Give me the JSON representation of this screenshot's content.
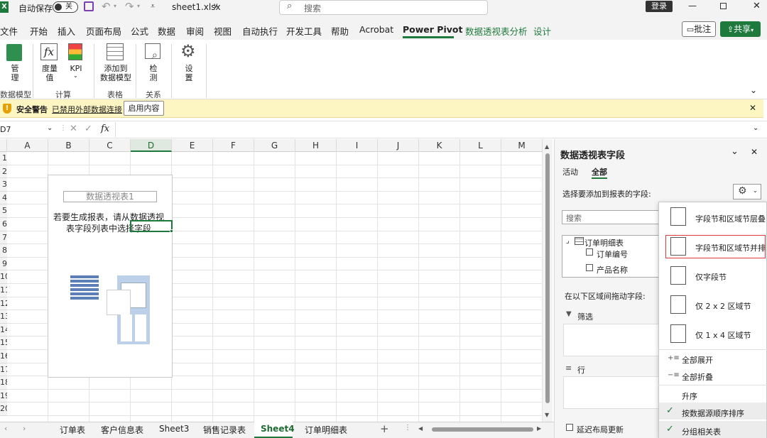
{
  "titlebar": {
    "autosave_label": "自动保存",
    "autosave_state": "关",
    "filename": "sheet1.xlsx",
    "filename_caret": "∨",
    "search_placeholder": "搜索",
    "login": "登录"
  },
  "menu": {
    "items": [
      "文件",
      "开始",
      "插入",
      "页面布局",
      "公式",
      "数据",
      "审阅",
      "视图",
      "自动执行",
      "开发工具",
      "帮助",
      "Acrobat",
      "Power Pivot",
      "数据透视表分析",
      "设计"
    ],
    "active": "Power Pivot",
    "comment": "批注",
    "share": "共享"
  },
  "ribbon": {
    "manage": "管\n理",
    "measures": "度量\n值",
    "kpi": "KPI",
    "add_to_model": "添加到\n数据模型",
    "detect": "检\n测",
    "settings": "设\n置",
    "groups": [
      "数据模型",
      "计算",
      "表格",
      "关系"
    ]
  },
  "security": {
    "title": "安全警告",
    "message": "已禁用外部数据连接",
    "button": "启用内容"
  },
  "formula": {
    "namebox": "D7",
    "fx": "fx"
  },
  "grid": {
    "columns": [
      "A",
      "B",
      "C",
      "D",
      "E",
      "F",
      "G",
      "H",
      "I",
      "J",
      "K",
      "L",
      "M"
    ],
    "selected_column": "D",
    "rows": [
      "1",
      "2",
      "3",
      "4",
      "5",
      "6",
      "7",
      "8",
      "9",
      "10",
      "11",
      "12",
      "13",
      "14",
      "15",
      "16",
      "17",
      "18",
      "19",
      "20"
    ]
  },
  "pivot": {
    "title": "数据透视表1",
    "instruction_line1": "若要生成报表，请从数据透视",
    "instruction_line2": "表字段列表中选择字段"
  },
  "sheets": {
    "tabs": [
      "订单表",
      "客户信息表",
      "Sheet3",
      "销售记录表",
      "Sheet4",
      "订单明细表"
    ],
    "active": "Sheet4"
  },
  "pane": {
    "title": "数据透视表字段",
    "tab_active": "活动",
    "tab_all": "全部",
    "choose_fields": "选择要添加到报表的字段:",
    "search_placeholder": "搜索",
    "table_name": "订单明细表",
    "field1": "订单编号",
    "field2": "产品名称",
    "drag_label": "在以下区域间拖动字段:",
    "filter_label": "筛选",
    "rows_label": "行",
    "defer_label": "延迟布局更新"
  },
  "dropdown": {
    "layout_stacked": "字段节和区域节层叠",
    "layout_side": "字段节和区域节并排",
    "fields_only": "仅字段节",
    "areas_2x2": "仅 2 x 2 区域节",
    "areas_1x4": "仅 1 x 4 区域节",
    "expand_all": "全部展开",
    "collapse_all": "全部折叠",
    "sort_asc": "升序",
    "sort_source": "按数据源顺序排序",
    "group_related": "分组相关表"
  },
  "colors": {
    "accent": "#1e7a3c",
    "highlight": "#e03a3a",
    "warning_bg": "#fdf6c3"
  }
}
